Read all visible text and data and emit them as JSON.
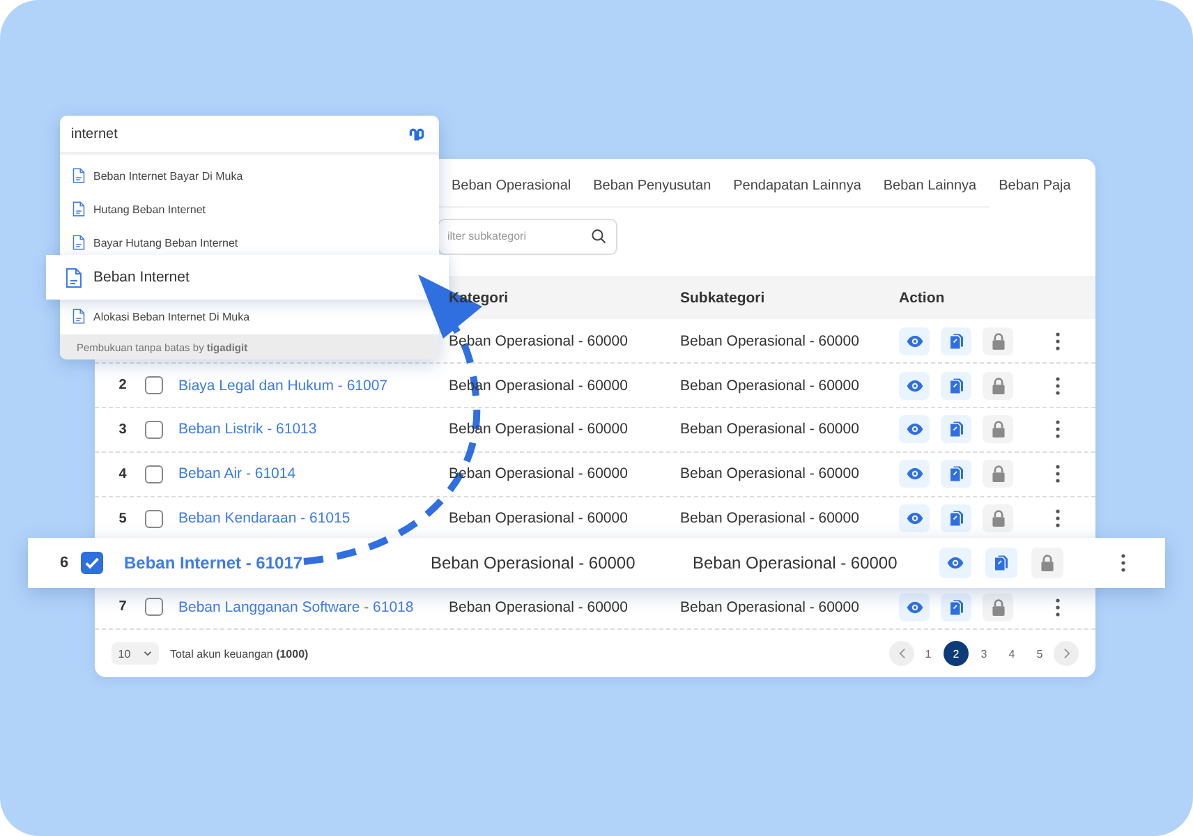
{
  "tabs": [
    {
      "label": "Beban Operasional"
    },
    {
      "label": "Beban Penyusutan"
    },
    {
      "label": "Pendapatan Lainnya"
    },
    {
      "label": "Beban Lainnya"
    },
    {
      "label": "Beban Paja"
    }
  ],
  "filter": {
    "placeholder": "ilter subkategori"
  },
  "table": {
    "columns": [
      "Kategori",
      "Subkategori",
      "Action"
    ],
    "rows": [
      {
        "kind": "row",
        "kategori": "Beban Operasional - 60000",
        "subkategori": "Beban Operasional - 60000"
      },
      {
        "kind": "row",
        "number": "2",
        "name": "Biaya Legal dan Hukum - 61007",
        "checked": false,
        "kategori": "Beban Operasional - 60000",
        "subkategori": "Beban Operasional - 60000"
      },
      {
        "kind": "row",
        "number": "3",
        "name": "Beban Listrik - 61013",
        "checked": false,
        "kategori": "Beban Operasional - 60000",
        "subkategori": "Beban Operasional - 60000"
      },
      {
        "kind": "row",
        "number": "4",
        "name": "Beban Air - 61014",
        "checked": false,
        "kategori": "Beban Operasional - 60000",
        "subkategori": "Beban Operasional - 60000"
      },
      {
        "kind": "row",
        "number": "5",
        "name": "Beban Kendaraan - 61015",
        "checked": false,
        "kategori": "Beban Operasional - 60000",
        "subkategori": "Beban Operasional - 60000"
      },
      {
        "kind": "raised",
        "number": "6",
        "name": "Beban Internet - 61017",
        "checked": true,
        "kategori": "Beban Operasional - 60000",
        "subkategori": "Beban Operasional - 60000"
      },
      {
        "kind": "row",
        "number": "7",
        "name": "Beban Langganan Software - 61018",
        "checked": false,
        "kategori": "Beban Operasional - 60000",
        "subkategori": "Beban Operasional - 60000"
      }
    ]
  },
  "pagination": {
    "page_size": "10",
    "total": "Total akun keuangan **(1000)**",
    "pages": [
      {
        "label": "1",
        "selected": false
      },
      {
        "label": "2",
        "selected": true
      },
      {
        "label": "3",
        "selected": false
      },
      {
        "label": "4",
        "selected": false
      },
      {
        "label": "5",
        "selected": false
      }
    ]
  },
  "search_popup": {
    "query": "internet",
    "items": [
      {
        "label": "Beban Internet Bayar Di Muka",
        "kind": "item"
      },
      {
        "label": "Hutang Beban Internet",
        "kind": "item"
      },
      {
        "label": "Bayar Hutang Beban Internet",
        "kind": "item"
      },
      {
        "label": "Beban Internet",
        "kind": "raised"
      },
      {
        "label": "Alokasi Beban Internet Di Muka",
        "kind": "item"
      }
    ],
    "footer": "Pembukuan tanpa batas by **tigadigit**"
  }
}
